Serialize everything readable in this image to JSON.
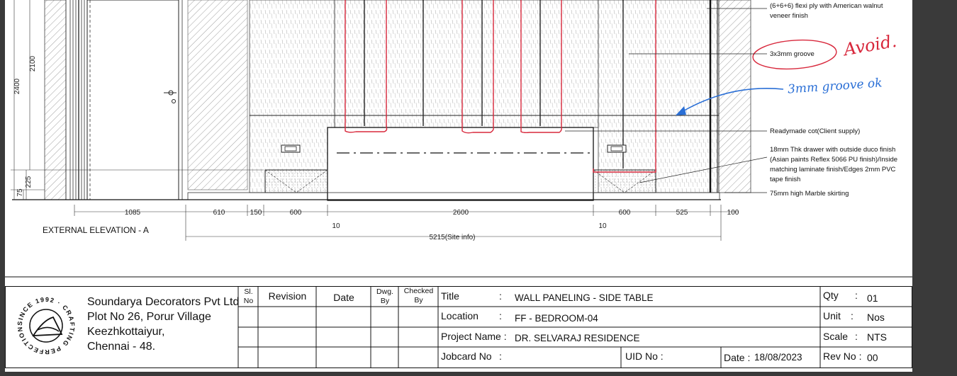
{
  "drawing": {
    "elevation_title": "EXTERNAL ELEVATION - A",
    "vertical_dims": [
      "2400",
      "2100",
      "225",
      "75"
    ],
    "horizontal_dims": [
      "1085",
      "610",
      "150",
      "600",
      "2600",
      "600",
      "525",
      "100"
    ],
    "offset_dims": [
      "10",
      "10"
    ],
    "overall_dim": "5215(Site info)",
    "notes": [
      "(6+6+6) flexi ply with American walnut\nveneer finish",
      "3x3mm groove",
      "Readymade cot(Client supply)",
      "18mm Thk drawer with outside duco finish\n(Asian paints Reflex 5066 PU finish)/Inside\nmatching laminate finish/Edges 2mm PVC\ntape finish",
      "75mm high Marble skirting"
    ],
    "handwritten": {
      "avoid": "Avoid.",
      "groove_ok": "3mm groove ok"
    },
    "annotation_colors": {
      "red": "#d8283c",
      "blue": "#2a6fd6"
    }
  },
  "title_block": {
    "company": {
      "name": "Soundarya Decorators Pvt Ltd",
      "address_1": "Plot No 26, Porur Village",
      "address_2": "Keezhkottaiyur,",
      "address_3": "Chennai - 48."
    },
    "logo_text": "SINCE 1992 · CRAFTING PERFECTION",
    "revision_headers": {
      "sl_no": "Sl.\nNo",
      "revision": "Revision",
      "date": "Date",
      "dwg_by": "Dwg.\nBy",
      "checked_by": "Checked\nBy"
    },
    "fields": {
      "title_label": "Title",
      "title_value": "WALL PANELING - SIDE TABLE",
      "location_label": "Location",
      "location_value": "FF - BEDROOM-04",
      "project_label": "Project Name :",
      "project_value": "DR. SELVARAJ RESIDENCE",
      "jobcard_label": "Jobcard No",
      "uid_label": "UID No :",
      "date_label": "Date :",
      "date_value": "18/08/2023",
      "colon": ":",
      "qty_label": "Qty",
      "qty_value": "01",
      "unit_label": "Unit",
      "unit_value": "Nos",
      "scale_label": "Scale",
      "scale_value": "NTS",
      "rev_label": "Rev No :",
      "rev_value": "00"
    }
  }
}
